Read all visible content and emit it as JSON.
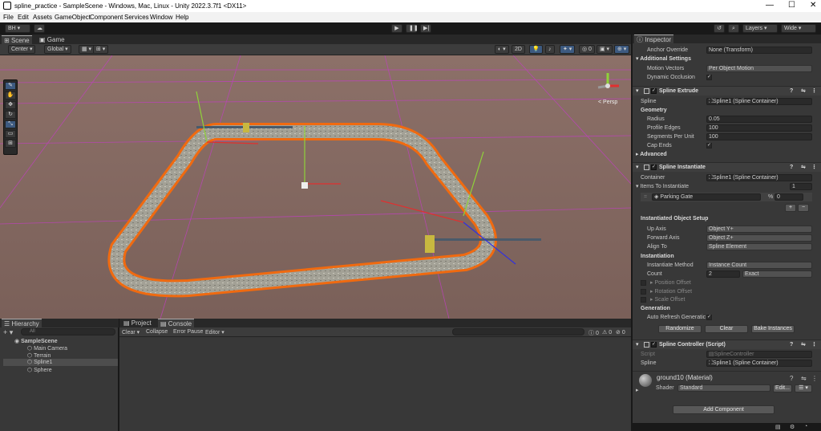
{
  "window": {
    "title": "spline_practice - SampleScene - Windows, Mac, Linux - Unity 2022.3.7f1 <DX11>"
  },
  "menu": [
    "File",
    "Edit",
    "Assets",
    "GameObject",
    "Component",
    "Services",
    "Window",
    "Help"
  ],
  "toolbar": {
    "account": "BH",
    "layers": "Layers",
    "layout": "Wide"
  },
  "scene": {
    "tab_scene": "Scene",
    "tab_game": "Game",
    "pivot": "Center",
    "space": "Global",
    "mode2d": "2D",
    "persp": "< Persp"
  },
  "hierarchy": {
    "title": "Hierarchy",
    "search": "All",
    "scene": "SampleScene",
    "items": [
      "Main Camera",
      "Terrain",
      "Spline1",
      "Sphere"
    ]
  },
  "project": {
    "tab_project": "Project",
    "tab_console": "Console",
    "clear": "Clear",
    "collapse": "Collapse",
    "error_pause": "Error Pause",
    "editor": "Editor",
    "count_log": "0",
    "count_warn": "0",
    "count_err": "0"
  },
  "inspector": {
    "title": "Inspector",
    "anchor_override": {
      "label": "Anchor Override",
      "value": "None (Transform)"
    },
    "additional_settings": "Additional Settings",
    "motion_vectors": {
      "label": "Motion Vectors",
      "value": "Per Object Motion"
    },
    "dynamic_occlusion": "Dynamic Occlusion",
    "spline_extrude": {
      "title": "Spline Extrude",
      "spline_label": "Spline",
      "spline_value": "Spline1 (Spline Container)",
      "geometry": "Geometry",
      "radius_label": "Radius",
      "radius": "0.05",
      "profile_label": "Profile Edges",
      "profile": "100",
      "segments_label": "Segments Per Unit",
      "segments": "100",
      "cap_label": "Cap Ends",
      "advanced": "Advanced"
    },
    "spline_instantiate": {
      "title": "Spline Instantiate",
      "container_label": "Container",
      "container_value": "Spline1 (Spline Container)",
      "items_label": "Items To Instantiate",
      "items_count": "1",
      "item_name": "Parking Gate",
      "item_pct": "%",
      "item_value": "0",
      "plus": "+",
      "minus": "−",
      "inst_setup": "Instantiated Object Setup",
      "up_label": "Up Axis",
      "up": "Object Y+",
      "fwd_label": "Forward Axis",
      "fwd": "Object Z+",
      "align_label": "Align To",
      "align": "Spline Element",
      "instantiation": "Instantiation",
      "method_label": "Instantiate Method",
      "method": "Instance Count",
      "count_label": "Count",
      "count": "2",
      "count_mode": "Exact",
      "pos_offset": "Position Offset",
      "rot_offset": "Rotation Offset",
      "scale_offset": "Scale Offset",
      "generation": "Generation",
      "auto_refresh": "Auto Refresh Generatic",
      "randomize": "Randomize",
      "clear": "Clear",
      "bake": "Bake Instances"
    },
    "spline_controller": {
      "title": "Spline Controller (Script)",
      "script_label": "Script",
      "script_value": "SplineController",
      "spline_label": "Spline",
      "spline_value": "Spline1 (Spline Container)"
    },
    "material": {
      "name": "ground10 (Material)",
      "shader_label": "Shader",
      "shader": "Standard",
      "edit": "Edit..."
    },
    "add_component": "Add Component"
  },
  "colors": {
    "accent": "#3d5a80",
    "track": "#f06a10",
    "bg": "#383838"
  }
}
